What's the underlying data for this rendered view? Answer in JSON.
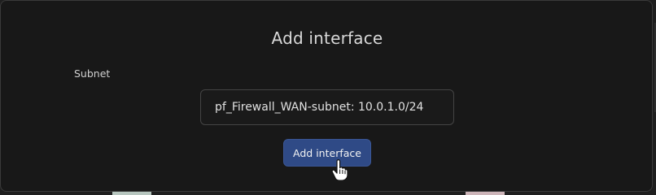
{
  "modal": {
    "title": "Add interface",
    "subnet_label": "Subnet",
    "subnet_value": "pf_Firewall_WAN-subnet: 10.0.1.0/24",
    "submit_label": "Add interface"
  },
  "icons": {
    "cursor": "hand-pointer-icon"
  },
  "colors": {
    "modal_background": "#181818",
    "button_background": "#2f4a86",
    "text": "#d8d8d8"
  }
}
